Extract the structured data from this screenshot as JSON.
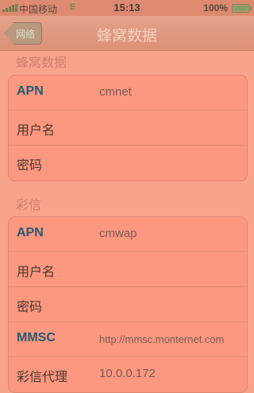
{
  "status": {
    "carrier": "中国移动",
    "network": "E",
    "time": "15:13",
    "battery": "100%"
  },
  "nav": {
    "back_label": "网络",
    "title": "蜂窝数据"
  },
  "cellular": {
    "header": "蜂窝数据",
    "rows": [
      {
        "label": "APN",
        "value": "cmnet"
      },
      {
        "label": "用户名",
        "value": ""
      },
      {
        "label": "密码",
        "value": ""
      }
    ]
  },
  "mms": {
    "header": "彩信",
    "rows": [
      {
        "label": "APN",
        "value": "cmwap"
      },
      {
        "label": "用户名",
        "value": ""
      },
      {
        "label": "密码",
        "value": ""
      },
      {
        "label": "MMSC",
        "value": "http://mmsc.monternet.com"
      },
      {
        "label": "彩信代理",
        "value": "10.0.0.172"
      }
    ]
  }
}
